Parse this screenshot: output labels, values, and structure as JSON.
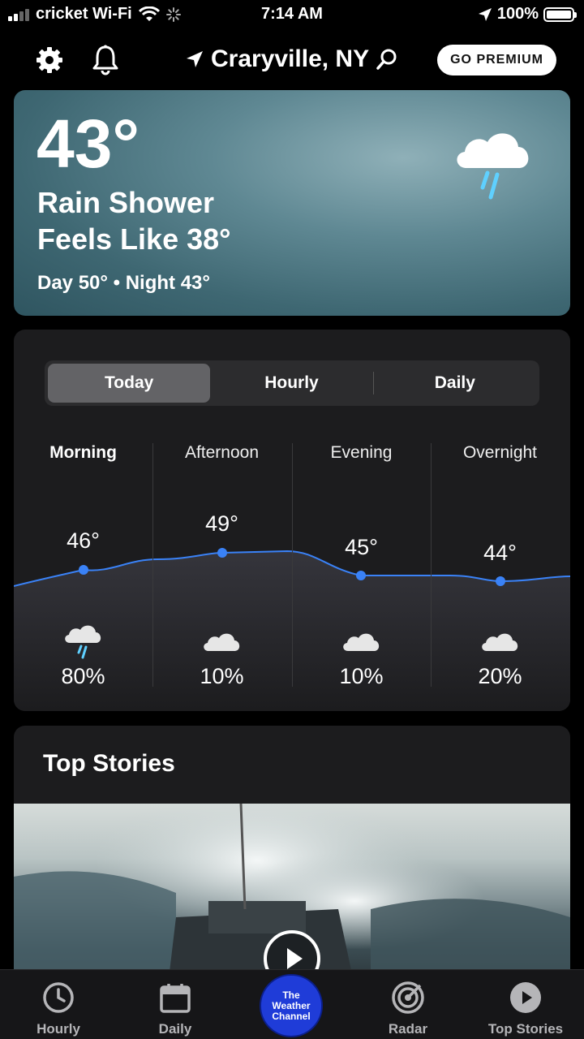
{
  "status_bar": {
    "carrier": "cricket Wi-Fi",
    "time": "7:14 AM",
    "battery": "100%"
  },
  "header": {
    "location": "Craryville, NY",
    "premium_button": "GO PREMIUM"
  },
  "current": {
    "temperature": "43°",
    "condition": "Rain Shower",
    "feels_like": "Feels Like 38°",
    "day_night": "Day 50° • Night 43°",
    "icon": "rain-cloud-icon"
  },
  "forecast": {
    "tabs": [
      "Today",
      "Hourly",
      "Daily"
    ],
    "active_tab": "Today",
    "periods": [
      {
        "name": "Morning",
        "temp": "46°",
        "precip": "80%",
        "icon": "rain-cloud-icon",
        "active": true
      },
      {
        "name": "Afternoon",
        "temp": "49°",
        "precip": "10%",
        "icon": "cloud-icon"
      },
      {
        "name": "Evening",
        "temp": "45°",
        "precip": "10%",
        "icon": "cloud-icon"
      },
      {
        "name": "Overnight",
        "temp": "44°",
        "precip": "20%",
        "icon": "cloud-icon"
      }
    ],
    "temps_numeric": [
      46,
      49,
      45,
      44
    ]
  },
  "top_stories": {
    "title": "Top Stories"
  },
  "tab_bar": {
    "items": [
      "Hourly",
      "Daily",
      "Radar",
      "Top Stories"
    ],
    "center_logo": "The Weather Channel"
  },
  "colors": {
    "accent_blue": "#3a82f7",
    "twc_blue": "#1f3cd8"
  }
}
